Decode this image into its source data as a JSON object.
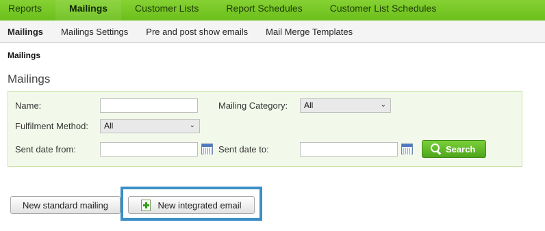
{
  "top_nav": {
    "items": [
      {
        "label": "Reports"
      },
      {
        "label": "Mailings"
      },
      {
        "label": "Customer Lists"
      },
      {
        "label": "Report Schedules"
      },
      {
        "label": "Customer List Schedules"
      }
    ],
    "active": "Mailings"
  },
  "sub_nav": {
    "items": [
      {
        "label": "Mailings"
      },
      {
        "label": "Mailings Settings"
      },
      {
        "label": "Pre and post show emails"
      },
      {
        "label": "Mail Merge Templates"
      }
    ],
    "active": "Mailings"
  },
  "breadcrumb": "Mailings",
  "page_title": "Mailings",
  "filters": {
    "name_label": "Name:",
    "name_value": "",
    "category_label": "Mailing Category:",
    "category_value": "All",
    "fulfilment_label": "Fulfilment Method:",
    "fulfilment_value": "All",
    "sent_from_label": "Sent date from:",
    "sent_from_value": "",
    "sent_to_label": "Sent date to:",
    "sent_to_value": "",
    "search_label": "Search"
  },
  "actions": {
    "new_standard_label": "New standard mailing",
    "new_integrated_label": "New integrated email"
  },
  "colors": {
    "nav_green": "#6bbf1b",
    "panel_bg": "#f3f9ea",
    "highlight_blue": "#3b8fc7"
  }
}
